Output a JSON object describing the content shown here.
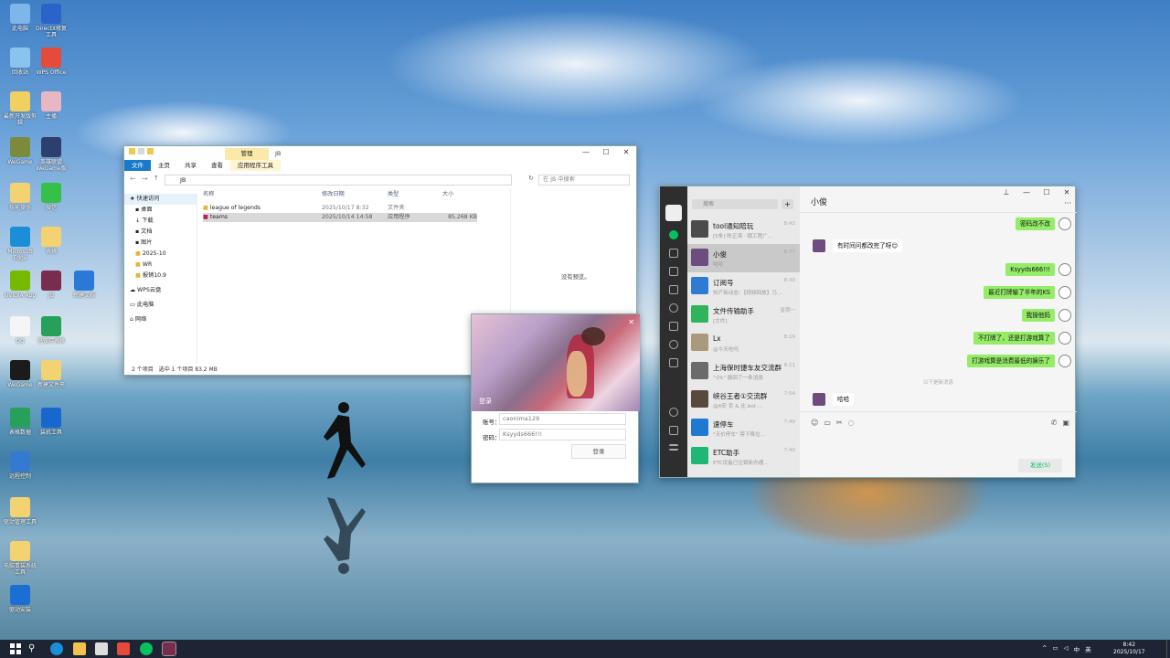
{
  "desktop": {
    "icons": [
      {
        "label": "此电脑",
        "color": "#7fb6ea"
      },
      {
        "label": "DirectX修复工具",
        "color": "#2a64c8"
      },
      {
        "label": "回收站",
        "color": "#8bc3ef"
      },
      {
        "label": "WPS Office",
        "color": "#e64a3b"
      },
      {
        "label": "最新开发版剪辑",
        "color": "#f0d060"
      },
      {
        "label": "主播",
        "color": "#e8b7c4"
      },
      {
        "label": "WeGame",
        "color": "#7c8a3c"
      },
      {
        "label": "英雄联盟WeGame版",
        "color": "#2c3f6e"
      },
      {
        "label": "技能操作",
        "color": "#f3d271"
      },
      {
        "label": "微信",
        "color": "#35c04a"
      },
      {
        "label": "Microsoft Edge",
        "color": "#1a8fd8"
      },
      {
        "label": "表格",
        "color": "#f3d271"
      },
      {
        "label": "NVIDIA App",
        "color": "#76b900"
      },
      {
        "label": "JB",
        "color": "#7a2c4e"
      },
      {
        "label": "新建文档",
        "color": "#2b79d6"
      },
      {
        "label": "QQ",
        "color": "#f5f5f5"
      },
      {
        "label": "已保存表格",
        "color": "#27a05a"
      },
      {
        "label": "WeGame",
        "color": "#1b1b1b"
      },
      {
        "label": "新建文件夹",
        "color": "#f3d271"
      },
      {
        "label": "表格数据",
        "color": "#27a05a"
      },
      {
        "label": "装机工具",
        "color": "#1767cf"
      },
      {
        "label": "远程控制",
        "color": "#3579d1"
      },
      {
        "label": "驱动管理工具",
        "color": "#f3d271"
      },
      {
        "label": "电脑重装系统工具",
        "color": "#f3d271"
      },
      {
        "label": "驱动安装",
        "color": "#1b6fd4"
      }
    ]
  },
  "explorer": {
    "title": "JB",
    "manage_tab": "管理",
    "tabs": [
      "文件",
      "主页",
      "共享",
      "查看",
      "应用程序工具"
    ],
    "path": "JB",
    "search_placeholder": "在 JB 中搜索",
    "nav": [
      "快速访问",
      "桌面",
      "下载",
      "文档",
      "图片",
      "2025-10",
      "WR",
      "报销10.9",
      "WPS云盘",
      "此电脑",
      "网络"
    ],
    "columns": [
      "名称",
      "修改日期",
      "类型",
      "大小"
    ],
    "files": [
      {
        "name": "league of legends",
        "date": "2025/10/17 8:32",
        "type": "文件夹",
        "size": ""
      },
      {
        "name": "teams",
        "date": "2025/10/14 14:58",
        "type": "应用程序",
        "size": "85,268 KB"
      }
    ],
    "preview_text": "没有预览。",
    "status": "2 个项目　选中 1 个项目  83.2 MB"
  },
  "login": {
    "title": "登录",
    "account_label": "账号：",
    "account_value": "caonima129",
    "password_label": "密码：",
    "password_value": "Ksyyds666!!!",
    "login_button": "登录"
  },
  "wechat": {
    "search_placeholder": "搜索",
    "chat_title": "小俊",
    "chats": [
      {
        "name": "tool通知陪玩",
        "preview": "[5条] 陈正涛 · 顺工程广...",
        "time": "8:42",
        "color": "#4b4b4b"
      },
      {
        "name": "小俊",
        "preview": "哈哈",
        "time": "8:37",
        "color": "#6d4c7e"
      },
      {
        "name": "订阅号",
        "preview": "知产新动态：【视频回放】马…",
        "time": "8:30",
        "color": "#2f7bd4"
      },
      {
        "name": "文件传输助手",
        "preview": "[文件]",
        "time": "星期一",
        "color": "#2fb35b"
      },
      {
        "name": "Lx",
        "preview": "@今天吃吗",
        "time": "8:19",
        "color": "#a99a7b"
      },
      {
        "name": "上海保时捷车友交流群",
        "preview": "\"小k\" 撤回了一条消息",
        "time": "8:11",
        "color": "#6b6b6b"
      },
      {
        "name": "峡谷王者①交流群",
        "preview": "@A安 农 & 比 bot …",
        "time": "7:54",
        "color": "#584a3a"
      },
      {
        "name": "速停车",
        "preview": "\"天价停车\" 旁下降位…",
        "time": "7:49",
        "color": "#1f78d1"
      },
      {
        "name": "ETC助手",
        "preview": "ETC设备已注销新办通…",
        "time": "7:40",
        "color": "#1fb676"
      }
    ],
    "messages": [
      {
        "from": "me",
        "text": "密码改不改"
      },
      {
        "from": "other",
        "text": "有时间问都改完了呀😊"
      },
      {
        "from": "me",
        "text": "Ksyyds666!!!"
      },
      {
        "from": "me",
        "text": "最近打牌输了半年的KS"
      },
      {
        "from": "me",
        "text": "我操他妈"
      },
      {
        "from": "me",
        "text": "不打牌了，还是打游戏算了"
      },
      {
        "from": "me",
        "text": "打游戏算是消费最低的娱乐了"
      },
      {
        "from": "other",
        "text": "哈哈"
      }
    ],
    "divider": "以下是新消息",
    "send_button": "发送(S)"
  },
  "taskbar": {
    "time": "8:42",
    "date": "2025/10/17",
    "ime": "中",
    "lang": "英"
  },
  "colors": {
    "accent": "#07c160",
    "explorer_blue": "#0078d7",
    "bubble_me": "#95ec69"
  }
}
